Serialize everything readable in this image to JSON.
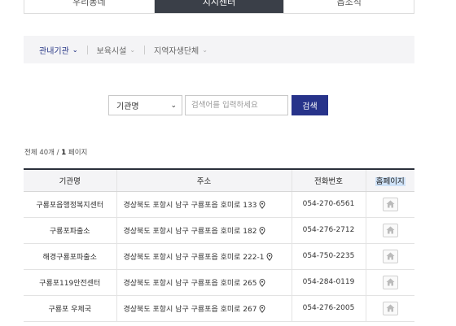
{
  "top_tabs": [
    {
      "label": "우리동네",
      "active": false
    },
    {
      "label": "지시센터",
      "active": true
    },
    {
      "label": "읍조직",
      "active": false
    }
  ],
  "subnav": {
    "items": [
      {
        "label": "관내기관",
        "active": true
      },
      {
        "label": "보육시설",
        "active": false
      },
      {
        "label": "지역자생단체",
        "active": false
      }
    ]
  },
  "search": {
    "select_value": "기관명",
    "placeholder": "검색어를 입력하세요",
    "button_label": "검색"
  },
  "count": {
    "prefix": "전체 40개 /",
    "page": "1",
    "suffix": "페이지"
  },
  "table": {
    "headers": [
      "기관명",
      "주소",
      "전화번호",
      "홈페이지"
    ],
    "rows": [
      {
        "name": "구룡포읍행정복지센터",
        "address": "경상북도 포항시 남구 구룡포읍 호미로 133",
        "phone": "054-270-6561"
      },
      {
        "name": "구룡포파출소",
        "address": "경상북도 포항시 남구 구룡포읍 호미로 182",
        "phone": "054-276-2712"
      },
      {
        "name": "해경구룡포파출소",
        "address": "경상북도 포항시 남구 구룡포읍 호미로 222-1",
        "phone": "054-750-2235"
      },
      {
        "name": "구룡포119안전센터",
        "address": "경상북도 포항시 남구 구룡포읍 호미로 265",
        "phone": "054-284-0119"
      },
      {
        "name": "구룡포 우체국",
        "address": "경상북도 포항시 남구 구룡포읍 호미로 267",
        "phone": "054-276-2005"
      }
    ]
  },
  "icons": {
    "pin": "map-pin-icon",
    "home": "home-icon",
    "chevron": "chevron-down-icon"
  },
  "colors": {
    "accent": "#27338a",
    "active_tab": "#3a3f48",
    "table_header_bg": "#f4f4f6"
  }
}
